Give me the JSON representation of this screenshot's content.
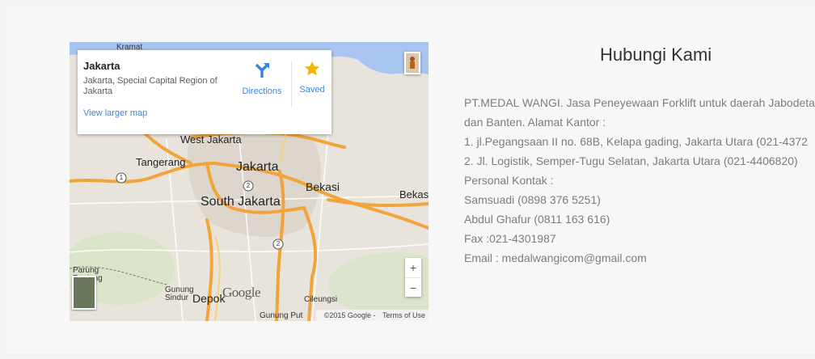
{
  "map": {
    "card": {
      "title": "Jakarta",
      "address": "Jakarta, Special Capital Region of Jakarta",
      "view_larger": "View larger map",
      "directions_label": "Directions",
      "saved_label": "Saved"
    },
    "places": {
      "kramat": "Kramat",
      "west_jakarta": "West Jakarta",
      "tangerang": "Tangerang",
      "jakarta": "Jakarta",
      "bekasi": "Bekasi",
      "bekasi_right": "Bekas",
      "south_jakarta": "South Jakarta",
      "parung_panjang": "Parung Panjang",
      "gunung_sindur": "Gunung Sindur",
      "depok": "Depok",
      "cileungsi": "Cileungsi",
      "gunung_putri": "Gunung Put"
    },
    "route_shields": [
      "1",
      "2",
      "2"
    ],
    "google_logo": "Google",
    "copyright": "©2015 Google -",
    "terms": "Terms of Use",
    "zoom_in": "+",
    "zoom_out": "−",
    "colors": {
      "road": "#f2a33a",
      "directions_icon": "#3a84df",
      "star": "#f4b400",
      "link": "#3a84df"
    }
  },
  "contact": {
    "heading": "Hubungi Kami",
    "lines": [
      "PT.MEDAL WANGI. Jasa Peneyewaan Forklift untuk daerah Jabodetabek",
      "dan Banten. Alamat Kantor :",
      "1. jl.Pegangsaan II no. 68B, Kelapa gading, Jakarta Utara (021-4372",
      "2. Jl. Logistik, Semper-Tugu Selatan, Jakarta Utara (021-4406820)",
      "Personal Kontak :",
      "Samsuadi (0898 376 5251)",
      "Abdul Ghafur (0811 163 616)",
      "Fax :021-4301987",
      "Email : medalwangicom@gmail.com"
    ]
  }
}
